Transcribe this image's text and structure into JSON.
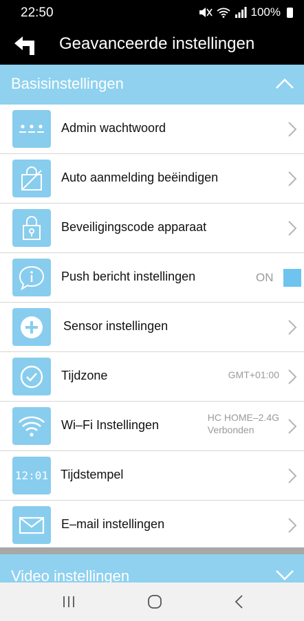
{
  "status_bar": {
    "time": "22:50",
    "battery": "100%",
    "icons": [
      "mute-icon",
      "wifi-icon",
      "signal-icon",
      "battery-icon"
    ]
  },
  "app_bar": {
    "back_icon": "back-arrow-icon",
    "title": "Geavanceerde instellingen"
  },
  "sections": {
    "basic": {
      "label": "Basisinstellingen",
      "expanded": true
    },
    "video": {
      "label": "Video instellingen",
      "expanded": false
    }
  },
  "rows": [
    {
      "icon": "password-dots-icon",
      "label": "Admin wachtwoord"
    },
    {
      "icon": "auto-login-off-icon",
      "label": "Auto aanmelding beëindigen"
    },
    {
      "icon": "lock-icon",
      "label": "Beveiligingscode apparaat"
    },
    {
      "icon": "info-bubble-icon",
      "label": "Push bericht instellingen",
      "toggle": "ON"
    },
    {
      "icon": "plus-circle-icon",
      "label": "Sensor instellingen"
    },
    {
      "icon": "clock-check-icon",
      "label": "Tijdzone",
      "value": "GMT+01:00"
    },
    {
      "icon": "wifi-icon",
      "label": "Wi–Fi Instellingen",
      "value_line1": "HC HOME–2.4G",
      "value_line2": "Verbonden"
    },
    {
      "icon": "timestamp-icon",
      "label": "Tijdstempel",
      "icon_text": "12:01"
    },
    {
      "icon": "envelope-icon",
      "label": "E–mail instellingen"
    }
  ],
  "colors": {
    "section_bg": "#8fd1ef",
    "icon_bg": "#88cdee",
    "toggle_on": "#6ec4ee",
    "app_bar_bg": "#000000"
  }
}
